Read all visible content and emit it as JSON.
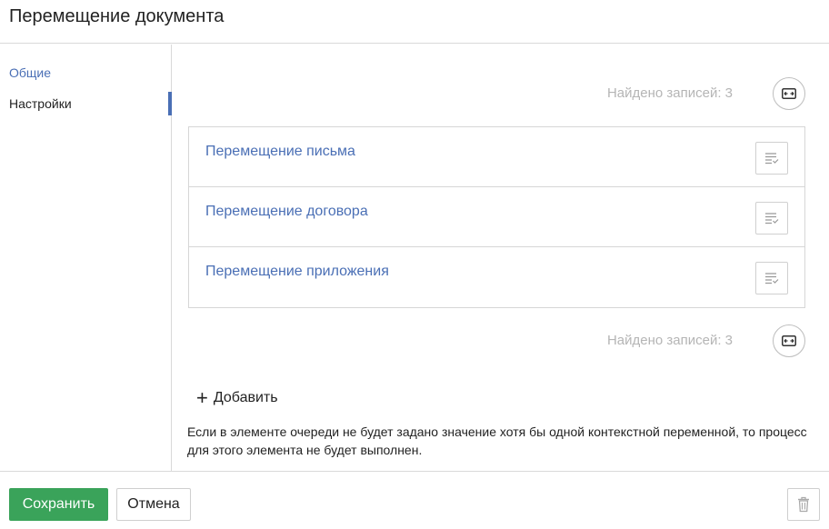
{
  "header": {
    "title": "Перемещение документа"
  },
  "sidebar": {
    "items": [
      {
        "label": "Общие"
      },
      {
        "label": "Настройки"
      }
    ]
  },
  "main": {
    "records_top": "Найдено записей: 3",
    "records_bottom": "Найдено записей: 3",
    "items": [
      {
        "label": "Перемещение письма"
      },
      {
        "label": "Перемещение договора"
      },
      {
        "label": "Перемещение приложения"
      }
    ],
    "add_label": "Добавить",
    "hint": "Если в элементе очереди не будет задано значение хотя бы одной контекстной переменной, то процесс для этого элемента не будет выполнен."
  },
  "footer": {
    "save_label": "Сохранить",
    "cancel_label": "Отмена"
  },
  "icons": {
    "expand": "expand-icon",
    "row_menu": "list-details-icon",
    "add": "plus-icon",
    "delete": "trash-icon"
  },
  "colors": {
    "accent": "#4a6fb5",
    "save": "#3aa35a",
    "muted": "#b5b5b5"
  }
}
